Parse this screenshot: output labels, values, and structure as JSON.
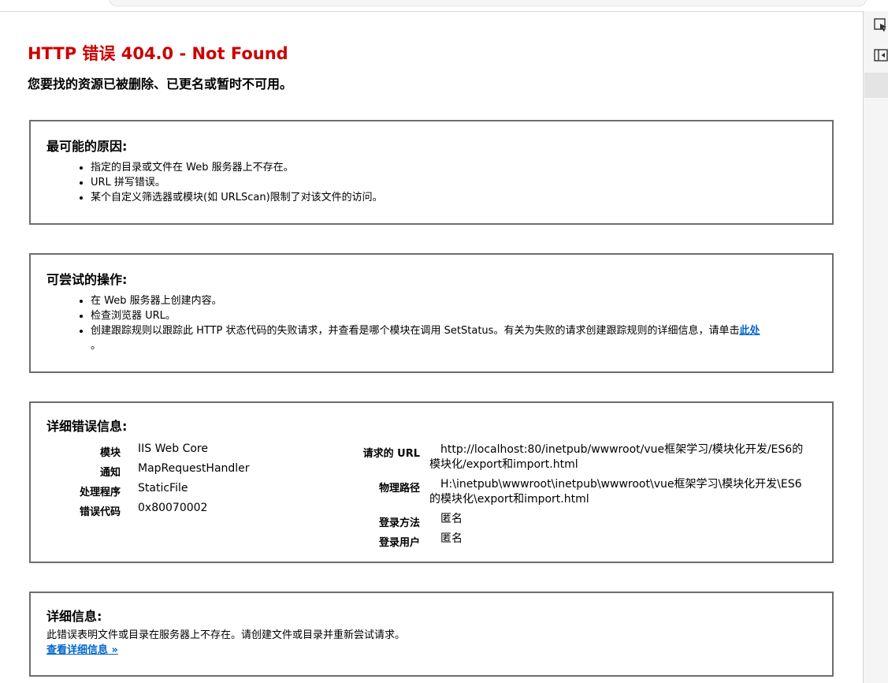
{
  "page": {
    "title": "HTTP 错误 404.0 - Not Found",
    "subtitle": "您要找的资源已被删除、已更名或暂时不可用。"
  },
  "causes": {
    "heading": "最可能的原因:",
    "items": [
      "指定的目录或文件在 Web 服务器上不存在。",
      "URL 拼写错误。",
      "某个自定义筛选器或模块(如 URLScan)限制了对该文件的访问。"
    ]
  },
  "actions": {
    "heading": "可尝试的操作:",
    "items": [
      "在 Web 服务器上创建内容。",
      "检查浏览器 URL。"
    ],
    "trace_text": "创建跟踪规则以跟踪此 HTTP 状态代码的失败请求，并查看是哪个模块在调用 SetStatus。有关为失败的请求创建跟踪规则的详细信息，请单击",
    "trace_link": "此处",
    "trace_end": "。"
  },
  "details": {
    "heading": "详细错误信息:",
    "left": [
      {
        "label": "模块",
        "value": "IIS Web Core"
      },
      {
        "label": "通知",
        "value": "MapRequestHandler"
      },
      {
        "label": "处理程序",
        "value": "StaticFile"
      },
      {
        "label": "错误代码",
        "value": "0x80070002"
      }
    ],
    "right": [
      {
        "label": "请求的 URL",
        "value_line1": "http://localhost:80/inetpub/wwwroot/vue框架学习/模块化开发/ES6的",
        "value_line2": "模块化/export和import.html"
      },
      {
        "label": "物理路径",
        "value_line1": "H:\\inetpub\\wwwroot\\inetpub\\wwwroot\\vue框架学习\\模块化开发\\ES6",
        "value_line2": "的模块化\\export和import.html"
      },
      {
        "label": "登录方法",
        "value_line1": "匿名",
        "value_line2": ""
      },
      {
        "label": "登录用户",
        "value_line1": "匿名",
        "value_line2": ""
      }
    ]
  },
  "more": {
    "heading": "详细信息:",
    "text": "此错误表明文件或目录在服务器上不存在。请创建文件或目录并重新尝试请求。",
    "link": "查看详细信息 »"
  },
  "colors": {
    "title": "#cc0000",
    "link": "#0066cc",
    "box_border": "#6d6d6d"
  }
}
